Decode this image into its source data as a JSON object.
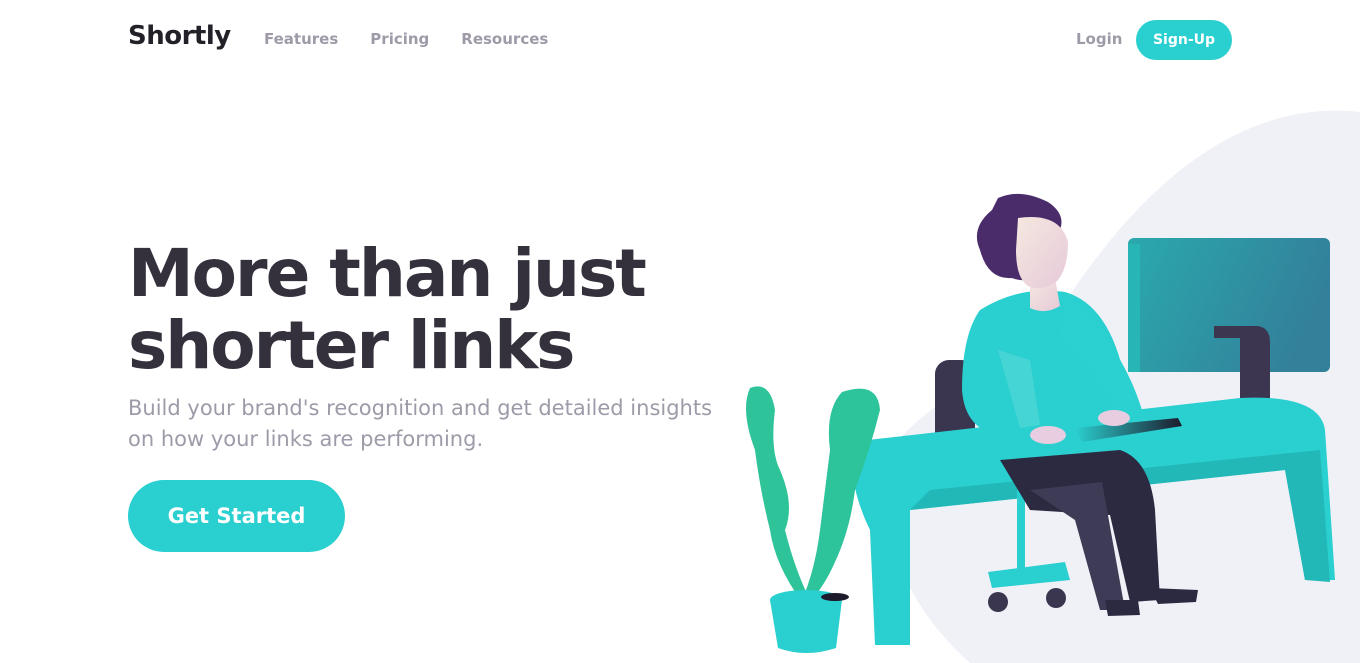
{
  "header": {
    "logo": "Shortly",
    "nav": [
      {
        "label": "Features"
      },
      {
        "label": "Pricing"
      },
      {
        "label": "Resources"
      }
    ],
    "login_label": "Login",
    "signup_label": "Sign-Up"
  },
  "hero": {
    "title": "More than just shorter links",
    "subtitle": "Build your brand's recognition and get detailed insights on how your links are performing.",
    "cta_label": "Get Started"
  },
  "colors": {
    "accent": "#2acfcf",
    "heading": "#34313d",
    "muted": "#9e9aa8",
    "plant": "#2fc39a",
    "hair": "#4b2c6b"
  }
}
